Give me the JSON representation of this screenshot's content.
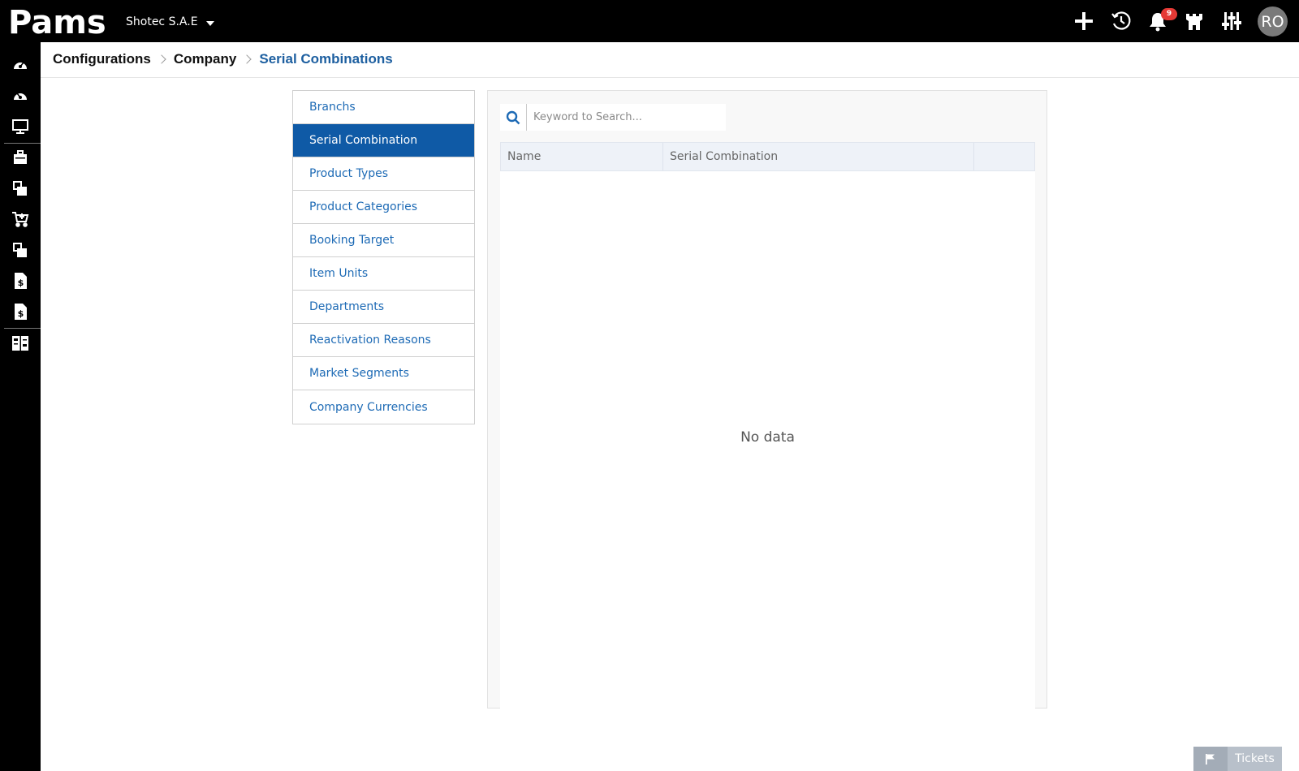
{
  "app": {
    "logo_text": "Pams",
    "company": "Shotec S.A.E"
  },
  "topbar": {
    "icons": [
      "plus-icon",
      "history-icon",
      "bell-icon",
      "castle-icon",
      "sliders-icon"
    ],
    "notification_count": "9",
    "avatar_initials": "RO"
  },
  "sidebar": {
    "icons": [
      "dashboard-icon",
      "dashboard-alt-icon",
      "monitor-icon",
      "briefcase-icon",
      "boxes-icon",
      "cart-icon",
      "boxes-alt-icon",
      "invoice-icon",
      "invoice-alt-icon",
      "report-icon"
    ]
  },
  "breadcrumb": {
    "items": [
      "Configurations",
      "Company",
      "Serial Combinations"
    ]
  },
  "menu": {
    "items": [
      "Branchs",
      "Serial Combination",
      "Product Types",
      "Product Categories",
      "Booking Target",
      "Item Units",
      "Departments",
      "Reactivation Reasons",
      "Market Segments",
      "Company Currencies"
    ],
    "active_index": 1
  },
  "search": {
    "placeholder": "Keyword to Search...",
    "value": ""
  },
  "table": {
    "columns": [
      "Name",
      "Serial Combination",
      ""
    ],
    "rows": [],
    "empty_text": "No data"
  },
  "tickets": {
    "label": "Tickets"
  },
  "colors": {
    "accent": "#0f5aa6",
    "link": "#1d6ab5",
    "topbar": "#000000",
    "badge": "#e53935"
  }
}
